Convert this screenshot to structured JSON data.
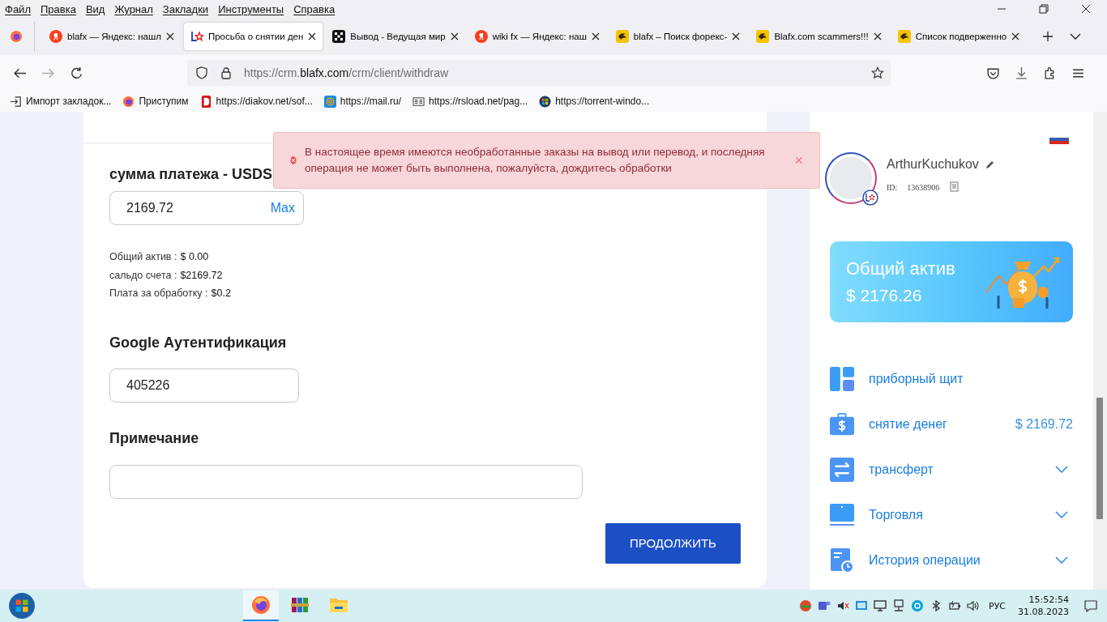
{
  "menu_bar": [
    "Файл",
    "Правка",
    "Вид",
    "Журнал",
    "Закладки",
    "Инструменты",
    "Справка"
  ],
  "tabs": [
    {
      "title": "blafx — Яндекс: нашл",
      "kind": "yandex",
      "selected": false
    },
    {
      "title": "Просьба о снятии ден",
      "kind": "blafx",
      "selected": true
    },
    {
      "title": "Вывод - Ведущая мир",
      "kind": "dots",
      "selected": false
    },
    {
      "title": "wiki fx — Яндекс: наш",
      "kind": "yandex",
      "selected": false
    },
    {
      "title": "blafx – Поиск форекс-",
      "kind": "bird",
      "selected": false
    },
    {
      "title": "Blafx.com scammers!!!",
      "kind": "bird",
      "selected": false
    },
    {
      "title": "Список подверженно",
      "kind": "bird",
      "selected": false
    }
  ],
  "address_bar": {
    "url_prefix": "https://crm.",
    "url_domain": "blafx.com",
    "url_path": "/crm/client/withdraw"
  },
  "bookmarks": [
    {
      "title": "Импорт закладок...",
      "kind": "import"
    },
    {
      "title": "Приступим",
      "kind": "firefox"
    },
    {
      "title": "https://diakov.net/sof...",
      "kind": "d"
    },
    {
      "title": "https://mail.ru/",
      "kind": "at"
    },
    {
      "title": "https://rsload.net/pag...",
      "kind": "rs"
    },
    {
      "title": "https://torrent-windo...",
      "kind": "windows"
    }
  ],
  "alert": {
    "message": "В настоящее время имеются необработанные заказы на вывод или перевод, и последняя операция не может быть выполнена, пожалуйста, дождитесь обработки",
    "close": "×"
  },
  "form": {
    "amount_heading": "сумма платежа - USDS",
    "amount_value": "2169.72",
    "max_link": "Max",
    "summary": [
      {
        "label": "Общий актив :",
        "value": "$ 0.00"
      },
      {
        "label": "сальдо счета :",
        "value": "$2169.72"
      },
      {
        "label": "Плата за обработку :",
        "value": "$0.2"
      }
    ],
    "auth_heading": "Google Аутентификация",
    "auth_value": "405226",
    "note_heading": "Примечание",
    "submit_button": "ПРОДОЛЖИТЬ"
  },
  "profile": {
    "name": "ArthurKuchukov",
    "id_label": "ID:",
    "id_value": "13638906"
  },
  "asset_card": {
    "title": "Общий актив",
    "amount": "$ 2176.26"
  },
  "sidebar": [
    {
      "label": "приборный щит",
      "kind": "link"
    },
    {
      "label": "снятие денег",
      "kind": "amount",
      "amount": "$ 2169.72"
    },
    {
      "label": "трансферт",
      "kind": "menu"
    },
    {
      "label": "Торговля",
      "kind": "menu"
    },
    {
      "label": "История операции",
      "kind": "menu"
    }
  ],
  "taskbar": {
    "apps": [
      {
        "kind": "firefox",
        "selected": true
      },
      {
        "kind": "winrar",
        "selected": false
      },
      {
        "kind": "folder",
        "selected": false
      }
    ],
    "language": "РУС",
    "time": "15:52:54",
    "date": "31.08.2023"
  }
}
